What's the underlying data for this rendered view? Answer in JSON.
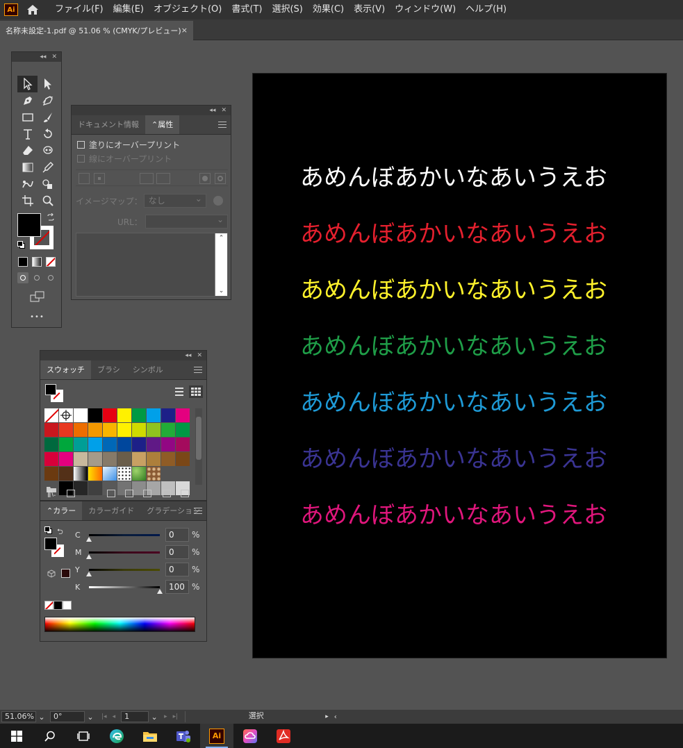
{
  "menubar": {
    "app_logo": "Ai",
    "items": [
      "ファイル(F)",
      "編集(E)",
      "オブジェクト(O)",
      "書式(T)",
      "選択(S)",
      "効果(C)",
      "表示(V)",
      "ウィンドウ(W)",
      "ヘルプ(H)"
    ]
  },
  "document_tab": {
    "title": "名称未設定-1.pdf @ 51.06 % (CMYK/プレビュー)",
    "close": "×"
  },
  "tools_panel": {
    "more": "•••",
    "colors": {
      "fill": "#000000",
      "stroke": "none"
    }
  },
  "attributes_panel": {
    "tabs": [
      "ドキュメント情報",
      "属性"
    ],
    "overprint_fill": "塗りにオーバープリント",
    "overprint_stroke": "線にオーバープリント",
    "imagemap_label": "イメージマップ：",
    "imagemap_value": "なし",
    "url_label": "URL："
  },
  "swatches_panel": {
    "tabs": [
      "スウォッチ",
      "ブラシ",
      "シンボル"
    ],
    "swatches": [
      "none",
      "registration",
      "#ffffff",
      "#000000",
      "#e60012",
      "#fff100",
      "#009944",
      "#00a0e9",
      "#1d2088",
      "#e4007f",
      "#c9171e",
      "#e83820",
      "#ed6d00",
      "#f39800",
      "#f8b500",
      "#fff100",
      "#cfdb00",
      "#8fc31f",
      "#22ac38",
      "#009944",
      "#00693e",
      "#00a73c",
      "#009e96",
      "#00a0e9",
      "#0068b7",
      "#00479d",
      "#1d2088",
      "#601986",
      "#920783",
      "#a40b5d",
      "#d7003a",
      "#e4007f",
      "#c8b99d",
      "#a59b8a",
      "#867a69",
      "#6a5d4a",
      "#c8a063",
      "#ad7f3b",
      "#8f5c26",
      "#7a4717",
      "#6b3a10",
      "#533018",
      "gradient-bw",
      "gradient-orange",
      "gradient-blue",
      "pattern-dots",
      "pattern-leaf",
      "pattern-floral",
      "",
      "",
      "folder",
      "#000000",
      "#262626",
      "#404040",
      "#595959",
      "#737373",
      "#8c8c8c",
      "#a6a6a6",
      "#bfbfbf",
      "#d9d9d9"
    ]
  },
  "color_panel": {
    "tabs": [
      "カラー",
      "カラーガイド",
      "グラデーション"
    ],
    "sliders": [
      {
        "label": "C",
        "value": "0",
        "unit": "%",
        "pos": 0,
        "track": "linear-gradient(to right,#000,#0b1d3a,#00184b)"
      },
      {
        "label": "M",
        "value": "0",
        "unit": "%",
        "pos": 0,
        "track": "linear-gradient(to right,#000,#3a0a1a,#4b0020)"
      },
      {
        "label": "Y",
        "value": "0",
        "unit": "%",
        "pos": 0,
        "track": "linear-gradient(to right,#000,#3a3a0a,#4b4b00)"
      },
      {
        "label": "K",
        "value": "100",
        "unit": "%",
        "pos": 1,
        "track": "linear-gradient(to right,#ffffff,#000000)"
      }
    ]
  },
  "artboard": {
    "lines": [
      {
        "text": "あめんぼあかいなあいうえお",
        "color": "#ffffff"
      },
      {
        "text": "あめんぼあかいなあいうえお",
        "color": "#e5202e"
      },
      {
        "text": "あめんぼあかいなあいうえお",
        "color": "#fff22b"
      },
      {
        "text": "あめんぼあかいなあいうえお",
        "color": "#1f9e48"
      },
      {
        "text": "あめんぼあかいなあいうえお",
        "color": "#1e9ad6"
      },
      {
        "text": "あめんぼあかいなあいうえお",
        "color": "#3a3493"
      },
      {
        "text": "あめんぼあかいなあいうえお",
        "color": "#e0167c"
      }
    ]
  },
  "statusbar": {
    "zoom": "51.06%",
    "rotation": "0°",
    "artboard_num": "1",
    "tool": "選択"
  },
  "taskbar": {
    "ai_label": "Ai"
  }
}
